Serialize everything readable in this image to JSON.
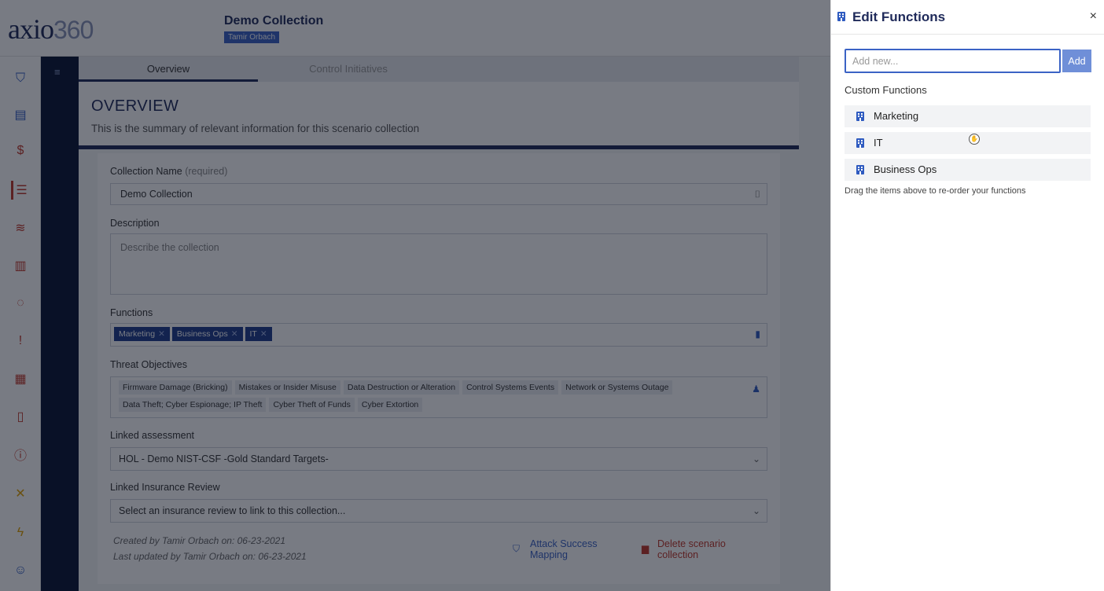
{
  "app": {
    "logo_text": "axio",
    "logo_num": "360",
    "collection_title": "Demo Collection",
    "user_badge": "Tamir Orbach"
  },
  "tabs": [
    {
      "label": "Overview"
    },
    {
      "label": "Control Initiatives"
    }
  ],
  "overview": {
    "heading": "OVERVIEW",
    "subtitle": "This is the summary of relevant information for this scenario collection"
  },
  "form": {
    "collection_name_label": "Collection Name",
    "collection_name_req": "(required)",
    "collection_name_value": "Demo Collection",
    "description_label": "Description",
    "description_placeholder": "Describe the collection",
    "functions_label": "Functions",
    "function_chips": [
      "Marketing",
      "Business Ops",
      "IT"
    ],
    "threat_label": "Threat Objectives",
    "threat_chips": [
      "Firmware Damage (Bricking)",
      "Mistakes or Insider Misuse",
      "Data Destruction or Alteration",
      "Control Systems Events",
      "Network or Systems Outage",
      "Data Theft; Cyber Espionage; IP Theft",
      "Cyber Theft of Funds",
      "Cyber Extortion"
    ],
    "linked_assessment_label": "Linked assessment",
    "linked_assessment_value": "HOL - Demo NIST-CSF -Gold Standard Targets-",
    "linked_insurance_label": "Linked Insurance Review",
    "linked_insurance_value": "Select an insurance review to link to this collection...",
    "created_by": "Created by Tamir Orbach on: 06-23-2021",
    "updated_by": "Last updated by Tamir Orbach on: 06-23-2021",
    "attack_mapping_line1": "Attack Success",
    "attack_mapping_line2": "Mapping",
    "delete_line1": "Delete scenario",
    "delete_line2": "collection"
  },
  "drawer": {
    "title": "Edit Functions",
    "close": "×",
    "add_placeholder": "Add new...",
    "add_button": "Add",
    "custom_label": "Custom Functions",
    "items": [
      {
        "label": "Marketing"
      },
      {
        "label": "IT"
      },
      {
        "label": "Business Ops"
      }
    ],
    "hint": "Drag the items above to re-order your functions"
  },
  "colors": {
    "brand_navy": "#1f2a5a",
    "accent_blue": "#3b63c5",
    "danger_red": "#c0392b"
  }
}
